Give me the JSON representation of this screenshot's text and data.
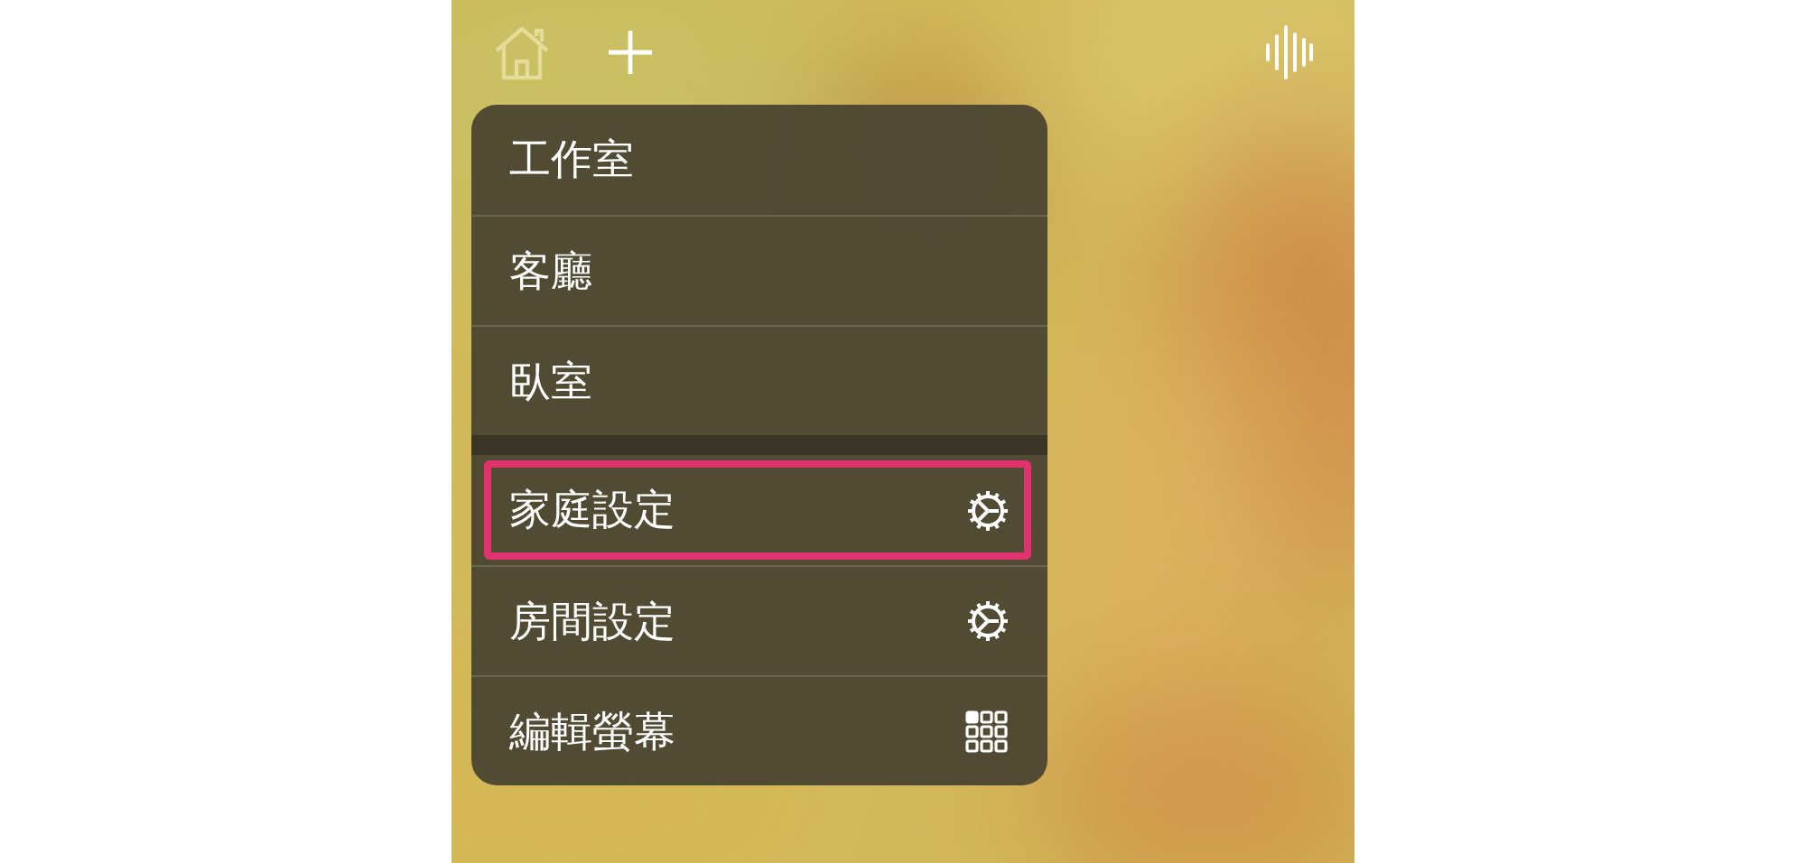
{
  "menu": {
    "groups": [
      {
        "items": [
          {
            "label": "工作室",
            "highlighted": false
          },
          {
            "label": "客廳",
            "highlighted": false
          },
          {
            "label": "臥室",
            "highlighted": false
          }
        ]
      },
      {
        "items": [
          {
            "label": "家庭設定",
            "kind": "settings",
            "highlighted": true
          },
          {
            "label": "房間設定",
            "kind": "settings",
            "highlighted": false
          },
          {
            "label": "編輯螢幕",
            "kind": "layout",
            "highlighted": false
          }
        ]
      }
    ]
  }
}
